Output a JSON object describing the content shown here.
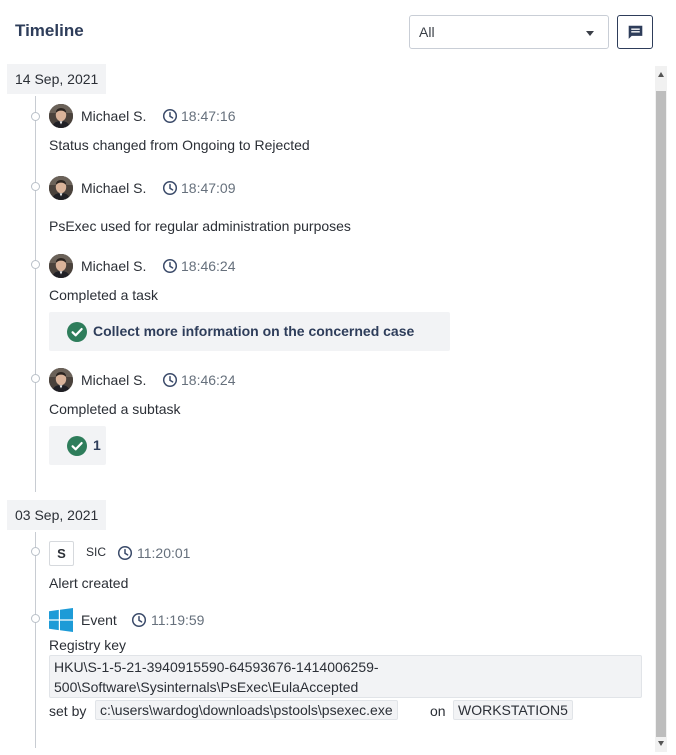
{
  "header": {
    "title": "Timeline",
    "filter_value": "All"
  },
  "icons": {
    "comment": "comment-icon",
    "clock": "clock-icon",
    "check": "check-circle-icon",
    "windows": "windows-icon",
    "avatar": "user-avatar",
    "dropdown": "chevron-down-icon"
  },
  "colors": {
    "title": "#2e3d5a",
    "check": "#2e7d5b",
    "chip_bg": "#f2f3f5",
    "windows_blue": "#1d9bd7"
  },
  "groups": [
    {
      "date": "14 Sep, 2021",
      "entries": [
        {
          "author": "Michael S.",
          "time": "18:47:16",
          "text": "Status changed from Ongoing to Rejected"
        },
        {
          "author": "Michael S.",
          "time": "18:47:09",
          "text": "PsExec used for regular administration purposes"
        },
        {
          "author": "Michael S.",
          "time": "18:46:24",
          "text": "Completed a task",
          "task": "Collect more information on the concerned case"
        },
        {
          "author": "Michael S.",
          "time": "18:46:24",
          "text": "Completed a subtask",
          "task": "1"
        }
      ]
    },
    {
      "date": "03 Sep, 2021",
      "entries": [
        {
          "badge": "S",
          "author": "SIC",
          "time": "11:20:01",
          "text": "Alert created"
        },
        {
          "author": "Event",
          "time": "11:19:59",
          "text": "Registry key",
          "registry_line1": "HKU\\S-1-5-21-3940915590-64593676-1414006259-",
          "registry_line2": "500\\Software\\Sysinternals\\PsExec\\EulaAccepted",
          "set_by_label": "set by",
          "process": "c:\\users\\wardog\\downloads\\pstools\\psexec.exe",
          "on_label": "on",
          "host": "WORKSTATION5"
        }
      ]
    }
  ]
}
